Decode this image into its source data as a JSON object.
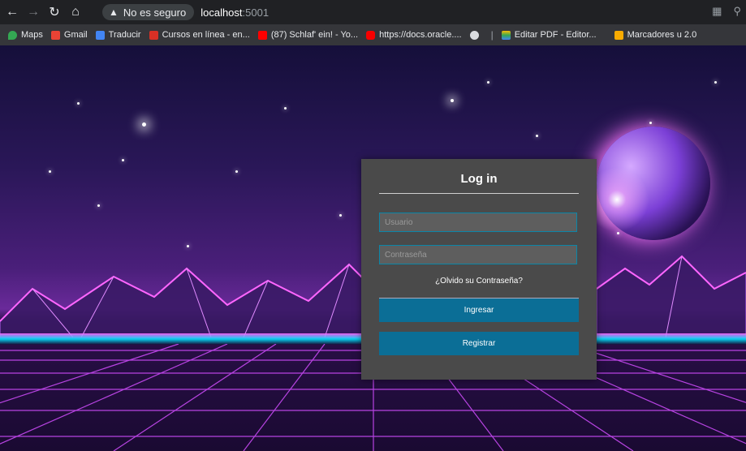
{
  "browser": {
    "secure_label": "No es seguro",
    "url_host": "localhost",
    "url_port": ":5001"
  },
  "bookmarks": [
    {
      "label": "Maps",
      "color": "#34a853"
    },
    {
      "label": "Gmail",
      "color": "#ea4335"
    },
    {
      "label": "Traducir",
      "color": "#4285f4"
    },
    {
      "label": "Cursos en línea - en...",
      "color": "#d93025"
    },
    {
      "label": "(87) Schlaf' ein! - Yo...",
      "color": "#ff0000"
    },
    {
      "label": "https://docs.oracle....",
      "color": "#f80000"
    },
    {
      "label": "",
      "color": "#9aa0a6"
    },
    {
      "label": "Editar PDF - Editor...",
      "color": "#fbbc04"
    },
    {
      "label": "Marcadores u 2.0",
      "color": "#f9ab00"
    }
  ],
  "login": {
    "title": "Log in",
    "username_placeholder": "Usuario",
    "password_placeholder": "Contraseña",
    "forgot_label": "¿Olvido su Contraseña?",
    "submit_label": "Ingresar",
    "register_label": "Registrar"
  },
  "theme": {
    "card_bg": "#4a4a4a",
    "button_bg": "#0b6e96",
    "input_border": "#0b86a8"
  }
}
